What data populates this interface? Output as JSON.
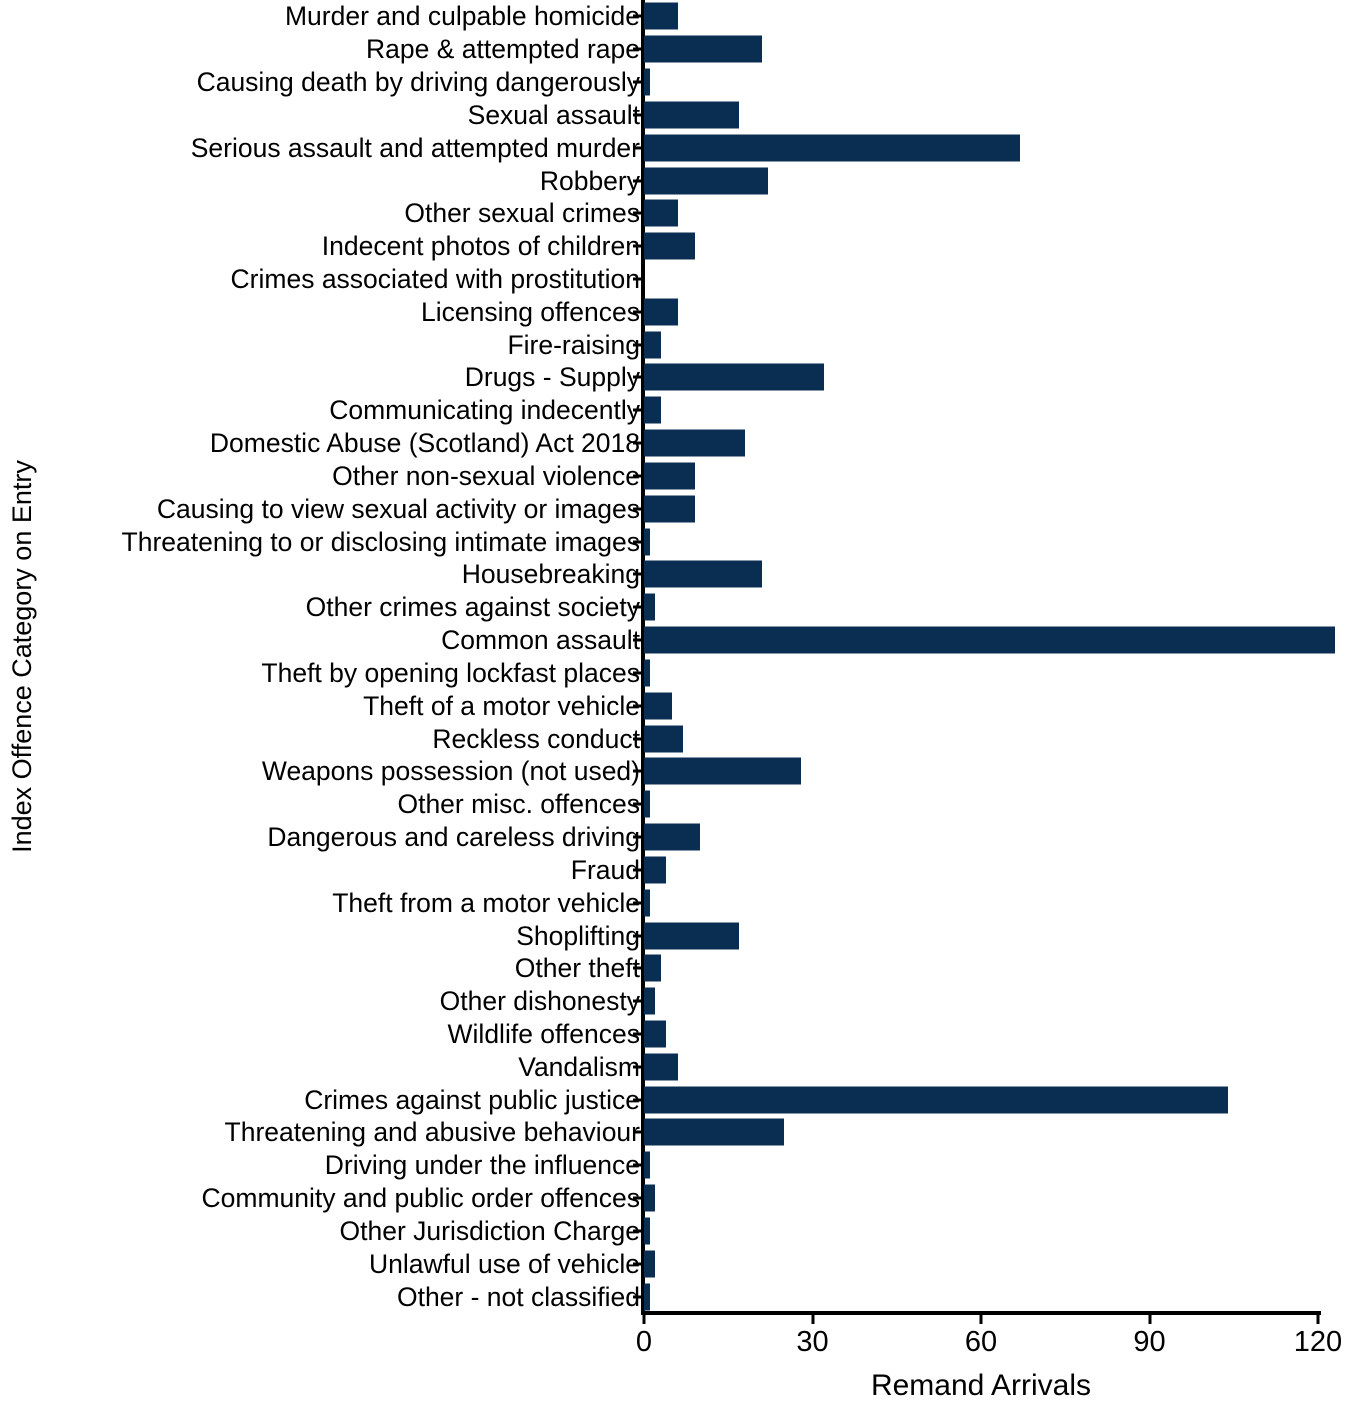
{
  "chart_data": {
    "type": "bar",
    "orientation": "horizontal",
    "title": "",
    "xlabel": "Remand Arrivals",
    "ylabel": "Index Offence Category on Entry",
    "xlim": [
      0,
      123.5
    ],
    "xticks": [
      0,
      30,
      60,
      90,
      120
    ],
    "xtick_labels": [
      "0",
      "30",
      "60",
      "90",
      "120"
    ],
    "grid": false,
    "legend": null,
    "bar_color": "#0a2e52",
    "categories": [
      "Murder and culpable homicide",
      "Rape & attempted rape",
      "Causing death by driving dangerously",
      "Sexual assault",
      "Serious assault and attempted murder",
      "Robbery",
      "Other sexual crimes",
      "Indecent photos of children",
      "Crimes associated with prostitution",
      "Licensing offences",
      "Fire-raising",
      "Drugs - Supply",
      "Communicating indecently",
      "Domestic Abuse (Scotland) Act 2018",
      "Other non-sexual violence",
      "Causing to view sexual activity or images",
      "Threatening to or disclosing intimate images",
      "Housebreaking",
      "Other crimes against society",
      "Common assault",
      "Theft by opening lockfast places",
      "Theft of a motor vehicle",
      "Reckless conduct",
      "Weapons possession (not used)",
      "Other misc. offences",
      "Dangerous and careless driving",
      "Fraud",
      "Theft from a motor vehicle",
      "Shoplifting",
      "Other theft",
      "Other dishonesty",
      "Wildlife offences",
      "Vandalism",
      "Crimes against public justice",
      "Threatening and abusive behaviour",
      "Driving under the influence",
      "Community and public order offences",
      "Other Jurisdiction Charge",
      "Unlawful use of vehicle",
      "Other - not classified"
    ],
    "values": [
      6,
      21,
      1,
      17,
      67,
      22,
      6,
      9,
      0,
      6,
      3,
      32,
      3,
      18,
      9,
      9,
      1,
      21,
      2,
      123,
      1,
      5,
      7,
      28,
      1,
      10,
      4,
      1,
      17,
      3,
      2,
      4,
      6,
      104,
      25,
      1,
      2,
      1,
      2,
      1
    ]
  }
}
